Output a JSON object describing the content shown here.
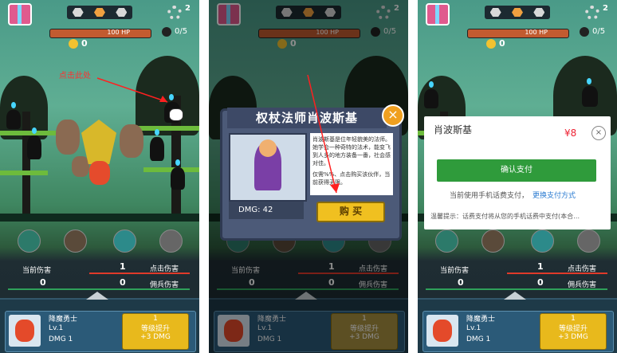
{
  "panel1": {
    "level_badge": "2",
    "hp_text": "100 HP",
    "enemy_count": "0/5",
    "coins": "0",
    "hint_text": "点击此处",
    "stats": {
      "left_label": "当前伤害",
      "left_value": "0",
      "tap_label": "点击伤害",
      "tap_value": "1",
      "mercenary_label": "佣兵伤害",
      "mercenary_value": "0"
    },
    "hero": {
      "name": "降魔勇士",
      "level": "Lv.1",
      "dmg": "DMG 1",
      "upgrade_cost": "1",
      "upgrade_label": "等级提升",
      "upgrade_bonus": "+3 DMG"
    }
  },
  "panel2": {
    "level_badge": "2",
    "hp_text": "100 HP",
    "enemy_count": "0/5",
    "coins": "0",
    "modal": {
      "title": "权杖法师肖波斯基",
      "dmg": "DMG: 42",
      "desc1": "肖波斯基是位年轻貌美的法师。她学会一种奇特的法术，能变飞到人多的地方装备一番，社会感对佳。",
      "desc2": "仅需%%、点击购买该伙伴，当前获得无限。",
      "buy_label": "购 买",
      "close": "×"
    },
    "stats": {
      "left_label": "当前伤害",
      "left_value": "0",
      "tap_label": "点击伤害",
      "tap_value": "1",
      "mercenary_label": "佣兵伤害",
      "mercenary_value": "0"
    },
    "hero": {
      "name": "降魔勇士",
      "level": "Lv.1",
      "dmg": "DMG 1",
      "upgrade_cost": "1",
      "upgrade_label": "等级提升",
      "upgrade_bonus": "+3 DMG"
    }
  },
  "panel3": {
    "level_badge": "2",
    "hp_text": "100 HP",
    "enemy_count": "0/5",
    "coins": "0",
    "pay": {
      "title": "肖波斯基",
      "price": "¥8",
      "close": "×",
      "confirm_label": "确认支付",
      "method_text": "当前使用手机话费支付，",
      "change_link": "更换支付方式",
      "warning": "温馨提示：话费支付将从您的手机话费中支付(本合…"
    },
    "stats": {
      "left_label": "当前伤害",
      "left_value": "0",
      "tap_label": "点击伤害",
      "tap_value": "1",
      "mercenary_label": "佣兵伤害",
      "mercenary_value": "0"
    },
    "hero": {
      "name": "降魔勇士",
      "level": "Lv.1",
      "dmg": "DMG 1",
      "upgrade_cost": "1",
      "upgrade_label": "等级提升",
      "upgrade_bonus": "+3 DMG"
    }
  },
  "colors": {
    "accent_gold": "#e8b91c",
    "pay_green": "#2f9b3b",
    "price_red": "#e22233",
    "hint_red": "#ff3030",
    "link_blue": "#2b7bd1"
  }
}
